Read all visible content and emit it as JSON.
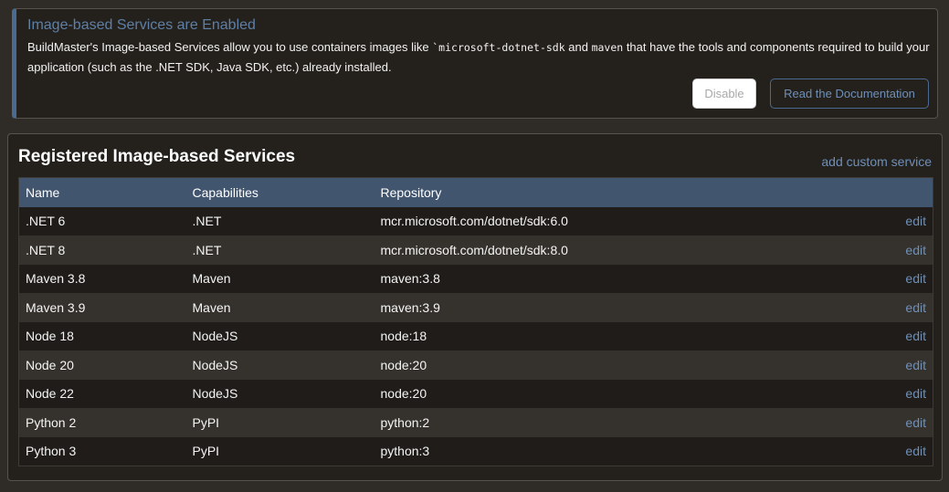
{
  "notice": {
    "title": "Image-based Services are Enabled",
    "text_before": "BuildMaster's Image-based Services allow you to use containers images like ",
    "code1": "`microsoft-dotnet-sdk",
    "text_mid": " and ",
    "code2": "maven",
    "text_after": " that have the tools and components required to build your application (such as the .NET SDK, Java SDK, etc.) already installed.",
    "disable_label": "Disable",
    "docs_label": "Read the Documentation"
  },
  "panel": {
    "title": "Registered Image-based Services",
    "add_link": "add custom service",
    "columns": [
      "Name",
      "Capabilities",
      "Repository"
    ],
    "edit_label": "edit",
    "rows": [
      {
        "name": ".NET 6",
        "capabilities": ".NET",
        "repository": "mcr.microsoft.com/dotnet/sdk:6.0"
      },
      {
        "name": ".NET 8",
        "capabilities": ".NET",
        "repository": "mcr.microsoft.com/dotnet/sdk:8.0"
      },
      {
        "name": "Maven 3.8",
        "capabilities": "Maven",
        "repository": "maven:3.8"
      },
      {
        "name": "Maven 3.9",
        "capabilities": "Maven",
        "repository": "maven:3.9"
      },
      {
        "name": "Node 18",
        "capabilities": "NodeJS",
        "repository": "node:18"
      },
      {
        "name": "Node 20",
        "capabilities": "NodeJS",
        "repository": "node:20"
      },
      {
        "name": "Node 22",
        "capabilities": "NodeJS",
        "repository": "node:20"
      },
      {
        "name": "Python 2",
        "capabilities": "PyPI",
        "repository": "python:2"
      },
      {
        "name": "Python 3",
        "capabilities": "PyPI",
        "repository": "python:3"
      }
    ]
  }
}
